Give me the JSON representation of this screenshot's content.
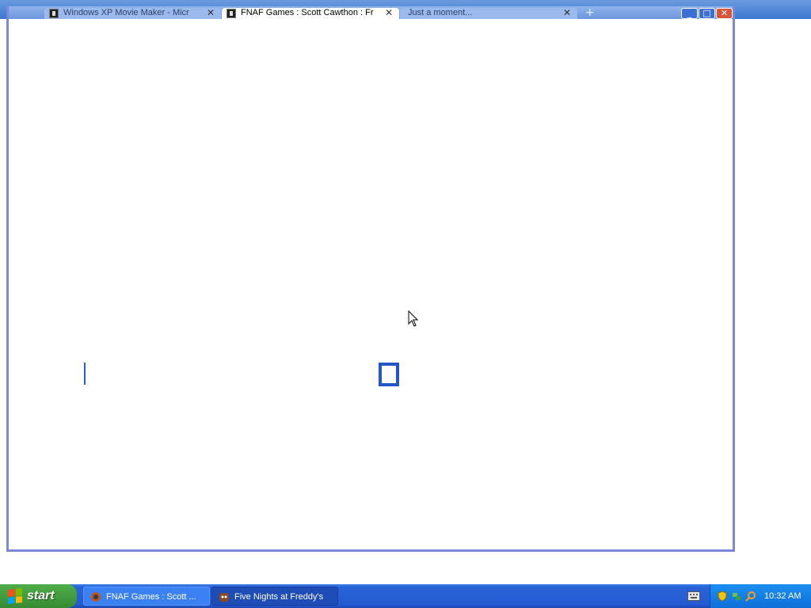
{
  "browser": {
    "tabs": [
      {
        "label": "Windows XP Movie Maker - Micr"
      },
      {
        "label": "FNAF Games : Scott Cawthon : Fr"
      },
      {
        "label": "Just a moment..."
      }
    ],
    "new_tab_symbol": "+",
    "controls": {
      "minimize": "_",
      "maximize": "□",
      "close": "✕"
    }
  },
  "taskbar": {
    "start_label": "start",
    "tasks": [
      {
        "label": "FNAF Games : Scott ..."
      },
      {
        "label": "Five Nights at Freddy's"
      }
    ],
    "clock": "10:32 AM"
  },
  "colors": {
    "xp_blue": "#245bd2",
    "start_green": "#3f9b3a",
    "accent": "#2356c7"
  }
}
